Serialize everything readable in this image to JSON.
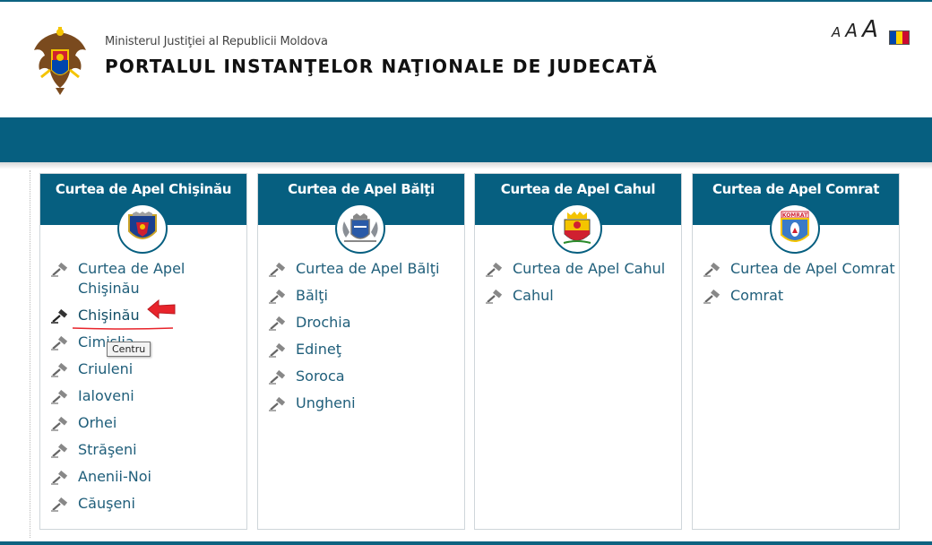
{
  "header": {
    "ministry": "Ministerul Justiţiei al Republicii Moldova",
    "portal_title": "PORTALUL INSTANŢELOR NAŢIONALE DE JUDECATĂ",
    "font_sizer": [
      "A",
      "A",
      "A"
    ]
  },
  "colors": {
    "primary": "#065f80",
    "link": "#1f5e7a",
    "annotation_red": "#e8242b",
    "flag": [
      "#0046ae",
      "#ffd200",
      "#cc092f"
    ]
  },
  "courts": [
    {
      "title": "Curtea de Apel Chişinău",
      "emblem": "chisinau-coat-of-arms-icon",
      "items": [
        "Curtea de Apel Chişinău",
        "Chişinău",
        "Cimişlia",
        "Criuleni",
        "Ialoveni",
        "Orhei",
        "Străşeni",
        "Anenii-Noi",
        "Căuşeni"
      ]
    },
    {
      "title": "Curtea de Apel Bălţi",
      "emblem": "balti-coat-of-arms-icon",
      "items": [
        "Curtea de Apel Bălţi",
        "Bălţi",
        "Drochia",
        "Edineţ",
        "Soroca",
        "Ungheni"
      ]
    },
    {
      "title": "Curtea de Apel Cahul",
      "emblem": "cahul-coat-of-arms-icon",
      "items": [
        "Curtea de Apel Cahul",
        "Cahul"
      ]
    },
    {
      "title": "Curtea de Apel Comrat",
      "emblem": "comrat-coat-of-arms-icon",
      "emblem_text": "KOMRAT",
      "items": [
        "Curtea de Apel Comrat",
        "Comrat"
      ]
    }
  ],
  "tooltip": "Centru"
}
